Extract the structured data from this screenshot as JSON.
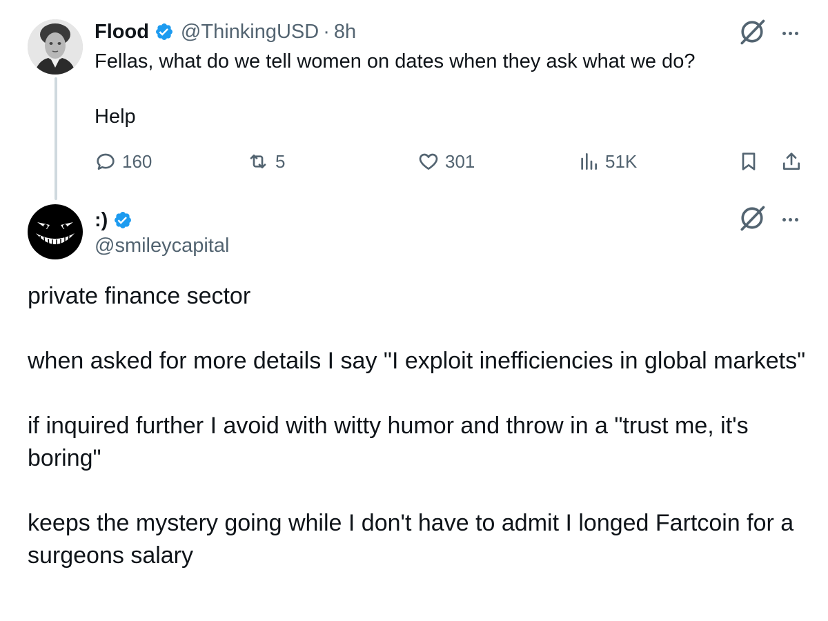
{
  "tweet1": {
    "display_name": "Flood",
    "handle": "@ThinkingUSD",
    "separator": "·",
    "time": "8h",
    "text_line1": "Fellas, what do we tell women on dates when they ask what we do?",
    "text_line2": "Help",
    "stats": {
      "replies": "160",
      "reposts": "5",
      "likes": "301",
      "views": "51K"
    },
    "verified": true
  },
  "tweet2": {
    "display_name": ":)",
    "handle": "@smileycapital",
    "verified": true,
    "paragraphs": [
      "private finance sector",
      "when asked for more details I say \"I exploit inefficiencies in global markets\"",
      "if inquired further I avoid with witty humor and throw in a \"trust me, it's boring\"",
      "keeps the mystery going while I don't have to admit I longed Fartcoin for a surgeons salary"
    ]
  },
  "icons": {
    "reply": "reply-icon",
    "repost": "repost-icon",
    "like": "like-icon",
    "views": "views-icon",
    "bookmark": "bookmark-icon",
    "share": "share-icon",
    "grok": "grok-icon",
    "more": "more-icon",
    "verified": "verified-badge-icon"
  },
  "colors": {
    "text_primary": "#0f1419",
    "text_secondary": "#536471",
    "verified_blue": "#1d9bf0",
    "thread_line": "#cfd9de"
  }
}
